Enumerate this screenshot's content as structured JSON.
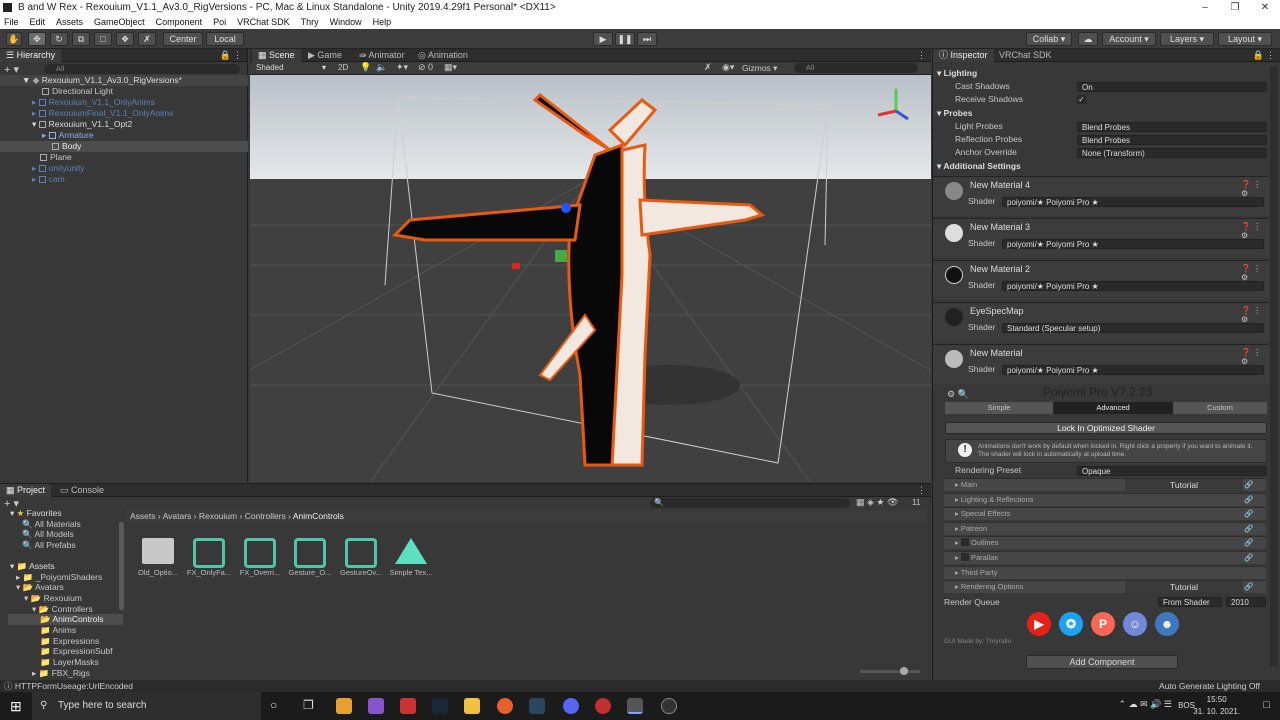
{
  "window": {
    "title": "B and W Rex - Rexouium_V1.1_Av3.0_RigVersions - PC, Mac & Linux Standalone - Unity 2019.4.29f1 Personal* <DX11>"
  },
  "menu": [
    "File",
    "Edit",
    "Assets",
    "GameObject",
    "Component",
    "Poi",
    "VRChat SDK",
    "Thry",
    "Window",
    "Help"
  ],
  "toolbar": {
    "center": "Center",
    "local": "Local",
    "collab": "Collab",
    "account": "Account",
    "layers": "Layers",
    "layout": "Layout"
  },
  "hierarchy": {
    "tab": "Hierarchy",
    "search": "All",
    "scene": "Rexouium_V1.1_Av3.0_RigVersions*",
    "items": [
      "Directional Light",
      "Rexouium_V1.1_OnlyAnims",
      "RexouiumFinal_V1.1_OnlyAnims",
      "Rexouium_V1.1_Opt2",
      "Armature",
      "Body",
      "Plane",
      "unityunity",
      "cam"
    ]
  },
  "scene": {
    "tabs": [
      "Scene",
      "Game",
      "Animator",
      "Animation"
    ],
    "shading": "Shaded",
    "mode2d": "2D",
    "gizmos": "Gizmos",
    "search": "All"
  },
  "inspector": {
    "tabs": [
      "Inspector",
      "VRChat SDK"
    ],
    "lighting": "Lighting",
    "cast_shadows_label": "Cast Shadows",
    "cast_shadows": "On",
    "receive_shadows_label": "Receive Shadows",
    "probes": "Probes",
    "light_probes_label": "Light Probes",
    "light_probes": "Blend Probes",
    "reflection_probes_label": "Reflection Probes",
    "reflection_probes": "Blend Probes",
    "anchor_label": "Anchor Override",
    "anchor": "None (Transform)",
    "additional": "Additional Settings",
    "shader_label": "Shader",
    "materials": [
      {
        "name": "New Material 4",
        "shader": "poiyomi/★ Poiyomi Pro ★"
      },
      {
        "name": "New Material 3",
        "shader": "poiyomi/★ Poiyomi Pro ★"
      },
      {
        "name": "New Material 2",
        "shader": "poiyomi/★ Poiyomi Pro ★"
      },
      {
        "name": "EyeSpecMap",
        "shader": "Standard (Specular setup)"
      },
      {
        "name": "New Material",
        "shader": "poiyomi/★ Poiyomi Pro ★"
      }
    ],
    "poi_title": "Poiyomi Pro V7.2.23",
    "poi_tabs": [
      "Simple",
      "Advanced",
      "Custom"
    ],
    "lock": "Lock In Optimized Shader",
    "warning": "Animations don't work by default when locked in. Right click a property if you want to animate it. The shader will lock in automatically at upload time.",
    "preset_label": "Rendering Preset",
    "preset": "Opaque",
    "sections": [
      "Main",
      "Lighting & Reflections",
      "Special Effects",
      "Patreon",
      "Outlines",
      "Parallax",
      "Third Party",
      "Rendering Options"
    ],
    "tutorial": "Tutorial",
    "queue_label": "Render Queue",
    "queue_from": "From Shader",
    "queue_value": "2010",
    "made_by": "GUI Made by: Thryrallo",
    "add_component": "Add Component"
  },
  "project": {
    "tabs": [
      "Project",
      "Console"
    ],
    "tree": [
      "Favorites",
      "All Materials",
      "All Models",
      "All Prefabs",
      "Assets",
      "_PoiyomiShaders",
      "Avatars",
      "Rexouium",
      "Controllers",
      "AnimControls",
      "Anims",
      "Expressions",
      "ExpressionSubf",
      "LayerMasks",
      "FBX_Rigs"
    ],
    "breadcrumb": [
      "Assets",
      "Avatars",
      "Rexouium",
      "Controllers",
      "AnimControls"
    ],
    "assets": [
      "Old_Optio...",
      "FX_OnlyFa...",
      "FX_Overri...",
      "Gesture_O...",
      "GestureOv...",
      "Simple Tex..."
    ],
    "count": "11"
  },
  "status": {
    "message": "HTTPFormUseage:UrlEncoded",
    "right": "Auto Generate Lighting Off"
  },
  "taskbar": {
    "search": "Type here to search",
    "lang": "BOS",
    "time": "15:50",
    "date": "31. 10. 2021."
  },
  "colors": {
    "youtube": "#e62117",
    "twitter": "#1da1f2",
    "patreon": "#f96854",
    "discord": "#7289da",
    "github": "#4078c0"
  }
}
